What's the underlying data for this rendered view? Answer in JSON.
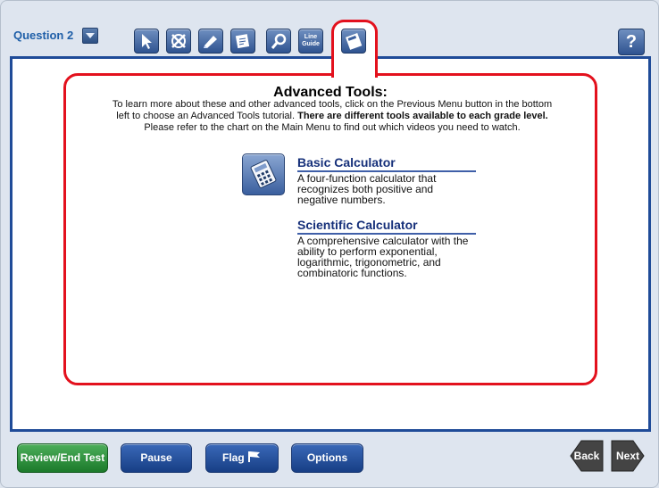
{
  "header": {
    "question_label": "Question 2",
    "line_guide_label": "Line\nGuide",
    "help_label": "?"
  },
  "toolbar": {
    "icons": [
      "pointer-icon",
      "eliminator-icon",
      "highlighter-icon",
      "notepad-icon",
      "magnifier-icon",
      "line-guide-icon",
      "calculator-icon"
    ]
  },
  "content": {
    "heading": "Advanced Tools:",
    "intro_text": "To learn more about these and other advanced tools, click on the Previous Menu button in the bottom left to choose an Advanced Tools tutorial.",
    "intro_bold": "There are different tools available to each grade level.",
    "intro_end": "Please refer to the chart on the Main Menu to find out which videos you need to watch.",
    "tools": [
      {
        "title": "Basic Calculator",
        "description": "A four-function calculator that recognizes both positive and negative numbers."
      },
      {
        "title": "Scientific Calculator",
        "description": "A comprehensive calculator with the ability to perform exponential, logarithmic, trigonometric, and combinatoric functions."
      }
    ]
  },
  "footer": {
    "review_label": "Review/End Test",
    "pause_label": "Pause",
    "flag_label": "Flag",
    "options_label": "Options",
    "back_label": "Back",
    "next_label": "Next"
  },
  "colors": {
    "accent_blue": "#1f4b98",
    "highlight_red": "#e3111d",
    "review_green": "#2e8c3c"
  }
}
